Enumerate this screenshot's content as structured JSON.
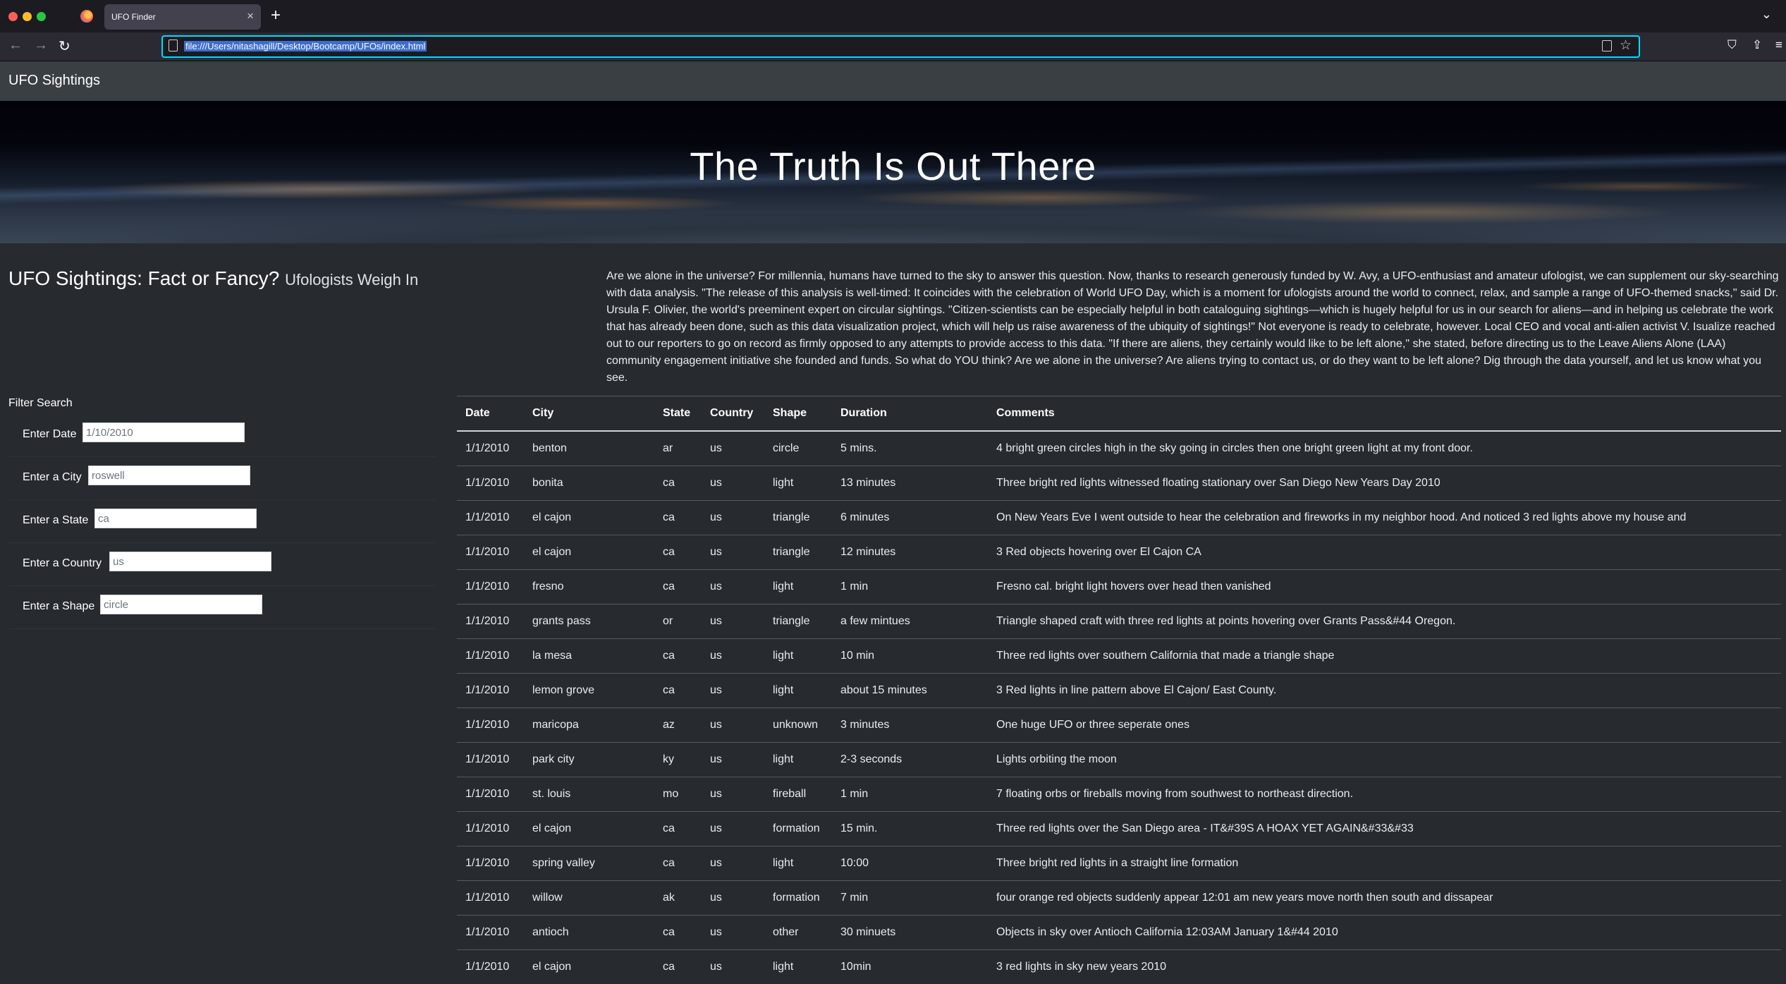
{
  "browser": {
    "tab_title": "UFO Finder",
    "url": "file:///Users/nitashagill/Desktop/Bootcamp/UFOs/index.html"
  },
  "nav": {
    "brand": "UFO Sightings"
  },
  "hero": {
    "title": "The Truth Is Out There"
  },
  "article": {
    "heading": "UFO Sightings: Fact or Fancy?",
    "subheading": "Ufologists Weigh In",
    "body": "Are we alone in the universe? For millennia, humans have turned to the sky to answer this question. Now, thanks to research generously funded by W. Avy, a UFO-enthusiast and amateur ufologist, we can supplement our sky-searching with data analysis. \"The release of this analysis is well-timed: It coincides with the celebration of World UFO Day, which is a moment for ufologists around the world to connect, relax, and sample a range of UFO-themed snacks,\" said Dr. Ursula F. Olivier, the world's preeminent expert on circular sightings. \"Citizen-scientists can be especially helpful in both cataloguing sightings—which is hugely helpful for us in our search for aliens—and in helping us celebrate the work that has already been done, such as this data visualization project, which will help us raise awareness of the ubiquity of sightings!\" Not everyone is ready to celebrate, however. Local CEO and vocal anti-alien activist V. Isualize reached out to our reporters to go on record as firmly opposed to any attempts to provide access to this data. \"If there are aliens, they certainly would like to be left alone,\" she stated, before directing us to the Leave Aliens Alone (LAA) community engagement initiative she founded and funds. So what do YOU think? Are we alone in the universe? Are aliens trying to contact us, or do they want to be left alone? Dig through the data yourself, and let us know what you see."
  },
  "filters": {
    "title": "Filter Search",
    "items": [
      {
        "label": "Enter Date",
        "placeholder": "1/10/2010"
      },
      {
        "label": "Enter a City",
        "placeholder": "roswell"
      },
      {
        "label": "Enter a State",
        "placeholder": "ca"
      },
      {
        "label": "Enter a Country",
        "placeholder": "us"
      },
      {
        "label": "Enter a Shape",
        "placeholder": "circle"
      }
    ]
  },
  "table": {
    "headers": [
      "Date",
      "City",
      "State",
      "Country",
      "Shape",
      "Duration",
      "Comments"
    ],
    "rows": [
      [
        "1/1/2010",
        "benton",
        "ar",
        "us",
        "circle",
        "5 mins.",
        "4 bright green circles high in the sky going in circles then one bright green light at my front door."
      ],
      [
        "1/1/2010",
        "bonita",
        "ca",
        "us",
        "light",
        "13 minutes",
        "Three bright red lights witnessed floating stationary over San Diego New Years Day 2010"
      ],
      [
        "1/1/2010",
        "el cajon",
        "ca",
        "us",
        "triangle",
        "6 minutes",
        "On New Years Eve I went outside to hear the celebration and fireworks in my neighbor hood. And noticed 3 red lights above my house and"
      ],
      [
        "1/1/2010",
        "el cajon",
        "ca",
        "us",
        "triangle",
        "12 minutes",
        "3 Red objects hovering over El Cajon CA"
      ],
      [
        "1/1/2010",
        "fresno",
        "ca",
        "us",
        "light",
        "1 min",
        "Fresno cal. bright light hovers over head then vanished"
      ],
      [
        "1/1/2010",
        "grants pass",
        "or",
        "us",
        "triangle",
        "a few mintues",
        "Triangle shaped craft with three red lights at points hovering over Grants Pass&#44 Oregon."
      ],
      [
        "1/1/2010",
        "la mesa",
        "ca",
        "us",
        "light",
        "10 min",
        "Three red lights over southern California that made a triangle shape"
      ],
      [
        "1/1/2010",
        "lemon grove",
        "ca",
        "us",
        "light",
        "about 15 minutes",
        "3 Red lights in line pattern above El Cajon/ East County."
      ],
      [
        "1/1/2010",
        "maricopa",
        "az",
        "us",
        "unknown",
        "3 minutes",
        "One huge UFO or three seperate ones"
      ],
      [
        "1/1/2010",
        "park city",
        "ky",
        "us",
        "light",
        "2-3 seconds",
        "Lights orbiting the moon"
      ],
      [
        "1/1/2010",
        "st. louis",
        "mo",
        "us",
        "fireball",
        "1 min",
        "7 floating orbs or fireballs moving from southwest to northeast direction."
      ],
      [
        "1/1/2010",
        "el cajon",
        "ca",
        "us",
        "formation",
        "15 min.",
        "Three red lights over the San Diego area - IT&#39S A HOAX YET AGAIN&#33&#33"
      ],
      [
        "1/1/2010",
        "spring valley",
        "ca",
        "us",
        "light",
        "10:00",
        "Three bright red lights in a straight line formation"
      ],
      [
        "1/1/2010",
        "willow",
        "ak",
        "us",
        "formation",
        "7 min",
        "four orange red objects suddenly appear 12:01 am new years move north then south and dissapear"
      ],
      [
        "1/1/2010",
        "antioch",
        "ca",
        "us",
        "other",
        "30 minuets",
        "Objects in sky over Antioch California 12:03AM January 1&#44 2010"
      ],
      [
        "1/1/2010",
        "el cajon",
        "ca",
        "us",
        "light",
        "10min",
        "3 red lights in sky new years 2010"
      ]
    ]
  }
}
